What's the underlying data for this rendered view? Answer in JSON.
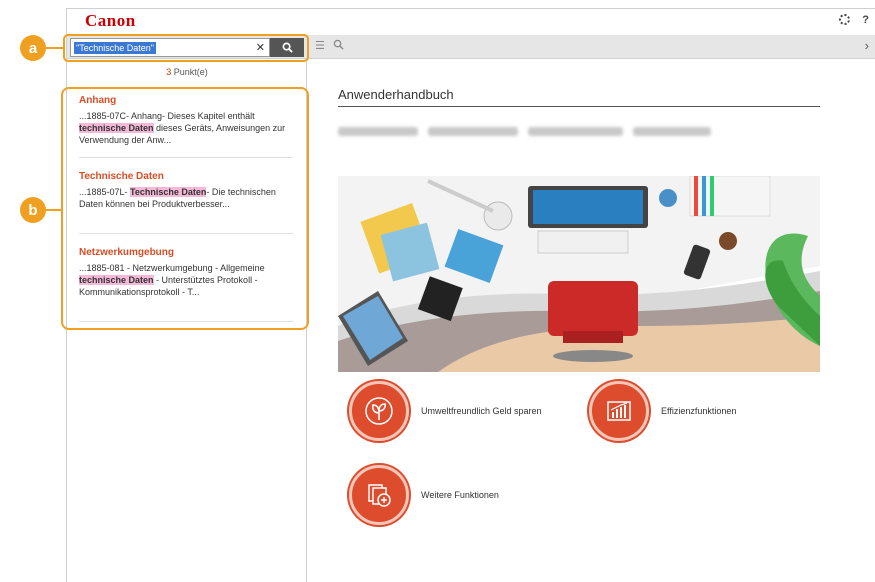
{
  "app": {
    "logo": "Canon"
  },
  "topbar": {
    "help_icon": "?"
  },
  "search": {
    "value": "\"Technische Daten\"",
    "clear": "✕",
    "button_icon": "search-icon"
  },
  "toolbar": {
    "list_icon": "☰",
    "search_icon": "⚲",
    "next_icon": "›"
  },
  "results": {
    "count": "3",
    "count_suffix": " Punkt(e)",
    "items": [
      {
        "title": "Anhang",
        "pre": "...1885-07C- Anhang- Dieses Kapitel enthält ",
        "hl": "technische Daten",
        "post": " dieses Geräts, Anweisungen zur Verwendung der Anw..."
      },
      {
        "title": "Technische Daten",
        "pre": "...1885-07L- ",
        "hl": "Technische Daten",
        "post": "- Die technischen Daten können bei Produktverbesser..."
      },
      {
        "title": "Netzwerkumgebung",
        "pre": "...1885-081 - Netzwerkumgebung - Allgemeine ",
        "hl": "technische Daten",
        "post": " - Unterstütztes Protokoll - Kommunikationsprotokoll - T..."
      }
    ]
  },
  "callouts": {
    "a": "a",
    "b": "b"
  },
  "main": {
    "title": "Anwenderhandbuch",
    "functions": [
      {
        "label": "Umweltfreundlich Geld sparen",
        "icon": "leaf-icon"
      },
      {
        "label": "Effizienzfunktionen",
        "icon": "chart-icon"
      },
      {
        "label": "Weitere Funktionen",
        "icon": "documents-icon"
      }
    ]
  },
  "colors": {
    "brand": "#cc0000",
    "accent": "#dd4c2c",
    "callout": "#f0a020",
    "highlight": "#f5b8d8"
  }
}
